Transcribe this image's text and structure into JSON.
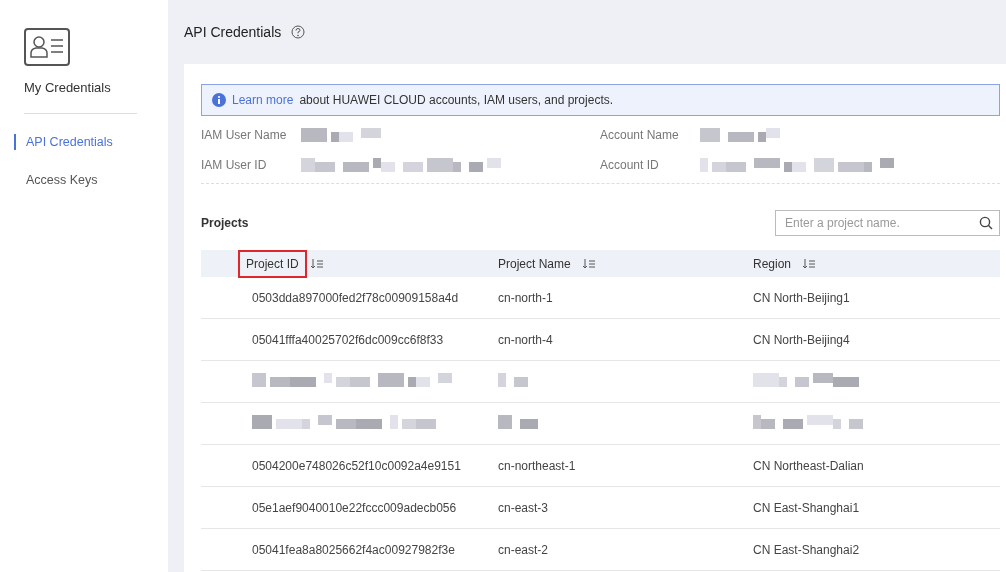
{
  "sidebar": {
    "title": "My Credentials",
    "items": [
      {
        "label": "API Credentials",
        "selected": true
      },
      {
        "label": "Access Keys",
        "selected": false
      }
    ]
  },
  "page": {
    "title": "API Credentials"
  },
  "notice": {
    "link": "Learn more",
    "text": "about HUAWEI CLOUD accounts, IAM users, and projects."
  },
  "fields": [
    {
      "label": "IAM User Name",
      "redacted": true
    },
    {
      "label": "Account Name",
      "redacted": true
    },
    {
      "label": "IAM User ID",
      "redacted": true
    },
    {
      "label": "Account ID",
      "redacted": true
    }
  ],
  "projects": {
    "title": "Projects",
    "search": {
      "placeholder": "Enter a project name."
    },
    "columns": [
      {
        "label": "Project ID",
        "highlighted": true
      },
      {
        "label": "Project Name",
        "highlighted": false
      },
      {
        "label": "Region",
        "highlighted": false
      }
    ],
    "rows": [
      {
        "kind": "data",
        "cells": [
          "0503dda897000fed2f78c00909158a4d",
          "cn-north-1",
          "CN North-Beijing1"
        ]
      },
      {
        "kind": "data",
        "cells": [
          "05041fffa40025702f6dc009cc6f8f33",
          "cn-north-4",
          "CN North-Beijing4"
        ]
      },
      {
        "kind": "redacted"
      },
      {
        "kind": "redacted"
      },
      {
        "kind": "data",
        "cells": [
          "0504200e748026c52f10c0092a4e9151",
          "cn-northeast-1",
          "CN Northeast-Dalian"
        ]
      },
      {
        "kind": "data",
        "cells": [
          "05e1aef9040010e22fccc009adecb056",
          "cn-east-3",
          "CN East-Shanghai1"
        ]
      },
      {
        "kind": "data",
        "cells": [
          "05041fea8a8025662f4ac00927982f3e",
          "cn-east-2",
          "CN East-Shanghai2"
        ]
      }
    ]
  }
}
